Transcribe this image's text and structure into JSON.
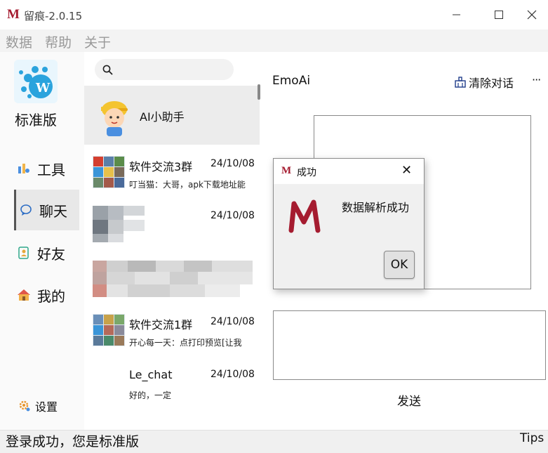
{
  "window": {
    "title": "留痕-2.0.15",
    "logo_glyph": "M",
    "accent": "#a51c30"
  },
  "menu": [
    "数据",
    "帮助",
    "关于"
  ],
  "edition": {
    "label": "标准版",
    "logo_glyph": "W"
  },
  "nav": [
    {
      "label": "工具",
      "icon": "tools-icon"
    },
    {
      "label": "聊天",
      "icon": "chat-icon"
    },
    {
      "label": "好友",
      "icon": "contacts-icon"
    },
    {
      "label": "我的",
      "icon": "home-icon"
    }
  ],
  "settings_label": "设置",
  "search": {
    "value": "",
    "placeholder": ""
  },
  "chats": [
    {
      "name": "AI小助手",
      "time": "",
      "message": ""
    },
    {
      "name": "软件交流3群",
      "time": "24/10/08",
      "message": "叮当猫：大哥，apk下载地址能"
    },
    {
      "name": "",
      "time": "24/10/08",
      "message": ""
    },
    {
      "name": "",
      "time": "",
      "message": ""
    },
    {
      "name": "软件交流1群",
      "time": "24/10/08",
      "message": "开心每一天：点打印预览[让我"
    },
    {
      "name": "Le_chat",
      "time": "24/10/08",
      "message": "好的，一定"
    }
  ],
  "conversation": {
    "title": "EmoAi",
    "clear_label": "清除对话",
    "more_label": "···",
    "send_label": "发送"
  },
  "status": {
    "text": "登录成功，您是标准版",
    "tips_label": "Tips"
  },
  "dialog": {
    "title": "成功",
    "logo_glyph": "M",
    "close_label": "✕",
    "mark_glyph": "M",
    "message": "数据解析成功",
    "ok_label": "OK"
  }
}
